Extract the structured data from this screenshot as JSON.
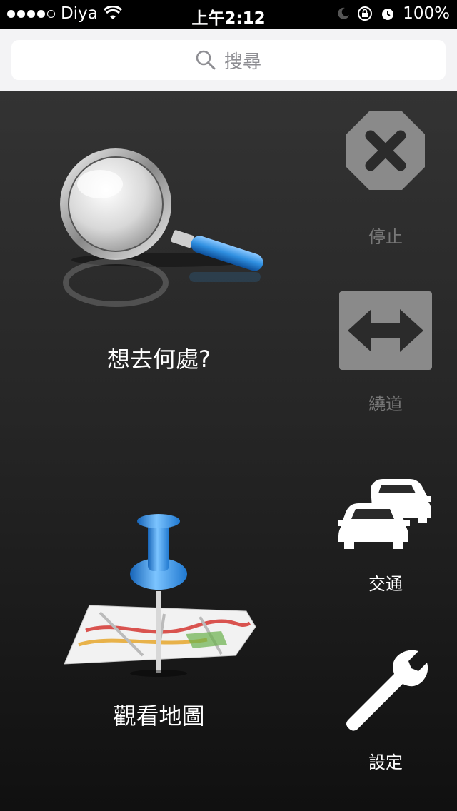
{
  "status_bar": {
    "carrier": "Diya",
    "time": "上午2:12",
    "battery": "100%",
    "signal_dots_filled": 4,
    "signal_dots_total": 5
  },
  "search": {
    "placeholder": "搜尋"
  },
  "main": {
    "where_to_label": "想去何處?",
    "view_map_label": "觀看地圖"
  },
  "sidebar": {
    "stop_label": "停止",
    "detour_label": "繞道",
    "traffic_label": "交通",
    "settings_label": "設定"
  },
  "colors": {
    "disabled_button": "#8a8a8a",
    "pin_blue": "#2f8fe0"
  }
}
